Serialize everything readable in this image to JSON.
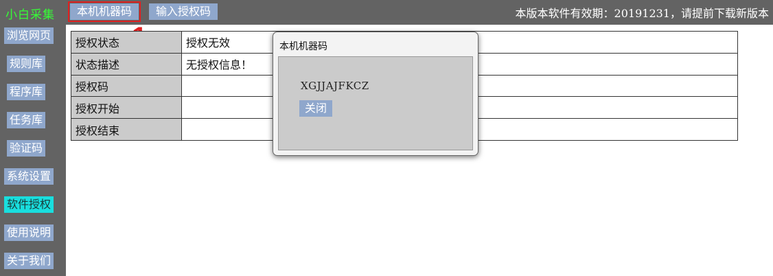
{
  "app": {
    "title": "小白采集"
  },
  "header": {
    "tabs": [
      {
        "label": "本机机器码",
        "active": true
      },
      {
        "label": "输入授权码",
        "active": false
      }
    ],
    "notice": "本版本软件有效期：20191231，请提前下载新版本"
  },
  "sidebar": {
    "items": [
      {
        "label": "浏览网页"
      },
      {
        "label": "规则库"
      },
      {
        "label": "程序库"
      },
      {
        "label": "任务库"
      },
      {
        "label": "验证码"
      },
      {
        "label": "系统设置"
      },
      {
        "label": "软件授权",
        "active": true
      },
      {
        "label": "使用说明"
      },
      {
        "label": "关于我们"
      }
    ]
  },
  "annotation": {
    "marker": "1"
  },
  "license_table": {
    "rows": [
      {
        "key": "授权状态",
        "value": "授权无效"
      },
      {
        "key": "状态描述",
        "value": "无授权信息！"
      },
      {
        "key": "授权码",
        "value": ""
      },
      {
        "key": "授权开始",
        "value": ""
      },
      {
        "key": "授权结束",
        "value": ""
      }
    ]
  },
  "dialog": {
    "title": "本机机器码",
    "machine_code": "XGJJAJFKCZ",
    "close_label": "关闭"
  },
  "colors": {
    "bar_bg": "#636363",
    "button_bg": "#8fa7cc",
    "active_side": "#19dede",
    "title_green": "#35ff35",
    "annotation_red": "#e02020"
  }
}
